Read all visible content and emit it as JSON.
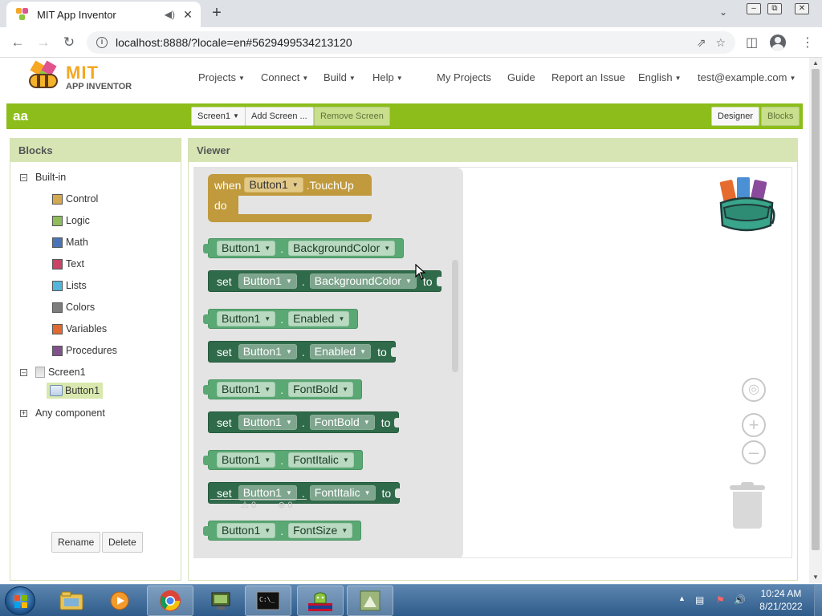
{
  "browser": {
    "tab_title": "MIT App Inventor",
    "url": "localhost:8888/?locale=en#5629499534213120"
  },
  "header": {
    "logo_line1": "MIT",
    "logo_line2": "APP INVENTOR",
    "menus": [
      {
        "label": "Projects"
      },
      {
        "label": "Connect"
      },
      {
        "label": "Build"
      },
      {
        "label": "Help"
      }
    ],
    "links": [
      "My Projects",
      "Guide",
      "Report an Issue"
    ],
    "language": "English",
    "account": "test@example.com"
  },
  "project_bar": {
    "project_name": "aa",
    "screen_select": "Screen1",
    "add_screen": "Add Screen ...",
    "remove_screen": "Remove Screen",
    "designer": "Designer",
    "blocks": "Blocks"
  },
  "blocks_panel": {
    "title": "Blocks",
    "builtin_label": "Built-in",
    "builtin": [
      {
        "label": "Control",
        "color": "#d4a94f"
      },
      {
        "label": "Logic",
        "color": "#8fbd5b"
      },
      {
        "label": "Math",
        "color": "#4a74b6"
      },
      {
        "label": "Text",
        "color": "#c94366"
      },
      {
        "label": "Lists",
        "color": "#53b5d9"
      },
      {
        "label": "Colors",
        "color": "#7d7d7d"
      },
      {
        "label": "Variables",
        "color": "#e06b32"
      },
      {
        "label": "Procedures",
        "color": "#80528c"
      }
    ],
    "screen": "Screen1",
    "component": "Button1",
    "any_component": "Any component",
    "rename": "Rename",
    "delete": "Delete"
  },
  "viewer": {
    "title": "Viewer",
    "event_block": {
      "when": "when",
      "component": "Button1",
      "event": ".TouchUp",
      "do": "do"
    },
    "blocks": [
      {
        "type": "get",
        "component": "Button1",
        "property": "BackgroundColor"
      },
      {
        "type": "set",
        "kw_set": "set",
        "component": "Button1",
        "property": "BackgroundColor",
        "kw_to": "to"
      },
      {
        "type": "get",
        "component": "Button1",
        "property": "Enabled"
      },
      {
        "type": "set",
        "kw_set": "set",
        "component": "Button1",
        "property": "Enabled",
        "kw_to": "to"
      },
      {
        "type": "get",
        "component": "Button1",
        "property": "FontBold"
      },
      {
        "type": "set",
        "kw_set": "set",
        "component": "Button1",
        "property": "FontBold",
        "kw_to": "to"
      },
      {
        "type": "get",
        "component": "Button1",
        "property": "FontItalic"
      },
      {
        "type": "set",
        "kw_set": "set",
        "component": "Button1",
        "property": "FontItalic",
        "kw_to": "to"
      },
      {
        "type": "get",
        "component": "Button1",
        "property": "FontSize"
      }
    ],
    "ghost_warnings": "0",
    "ghost_errors": "0"
  },
  "taskbar": {
    "time": "10:24 AM",
    "date": "8/21/2022"
  }
}
